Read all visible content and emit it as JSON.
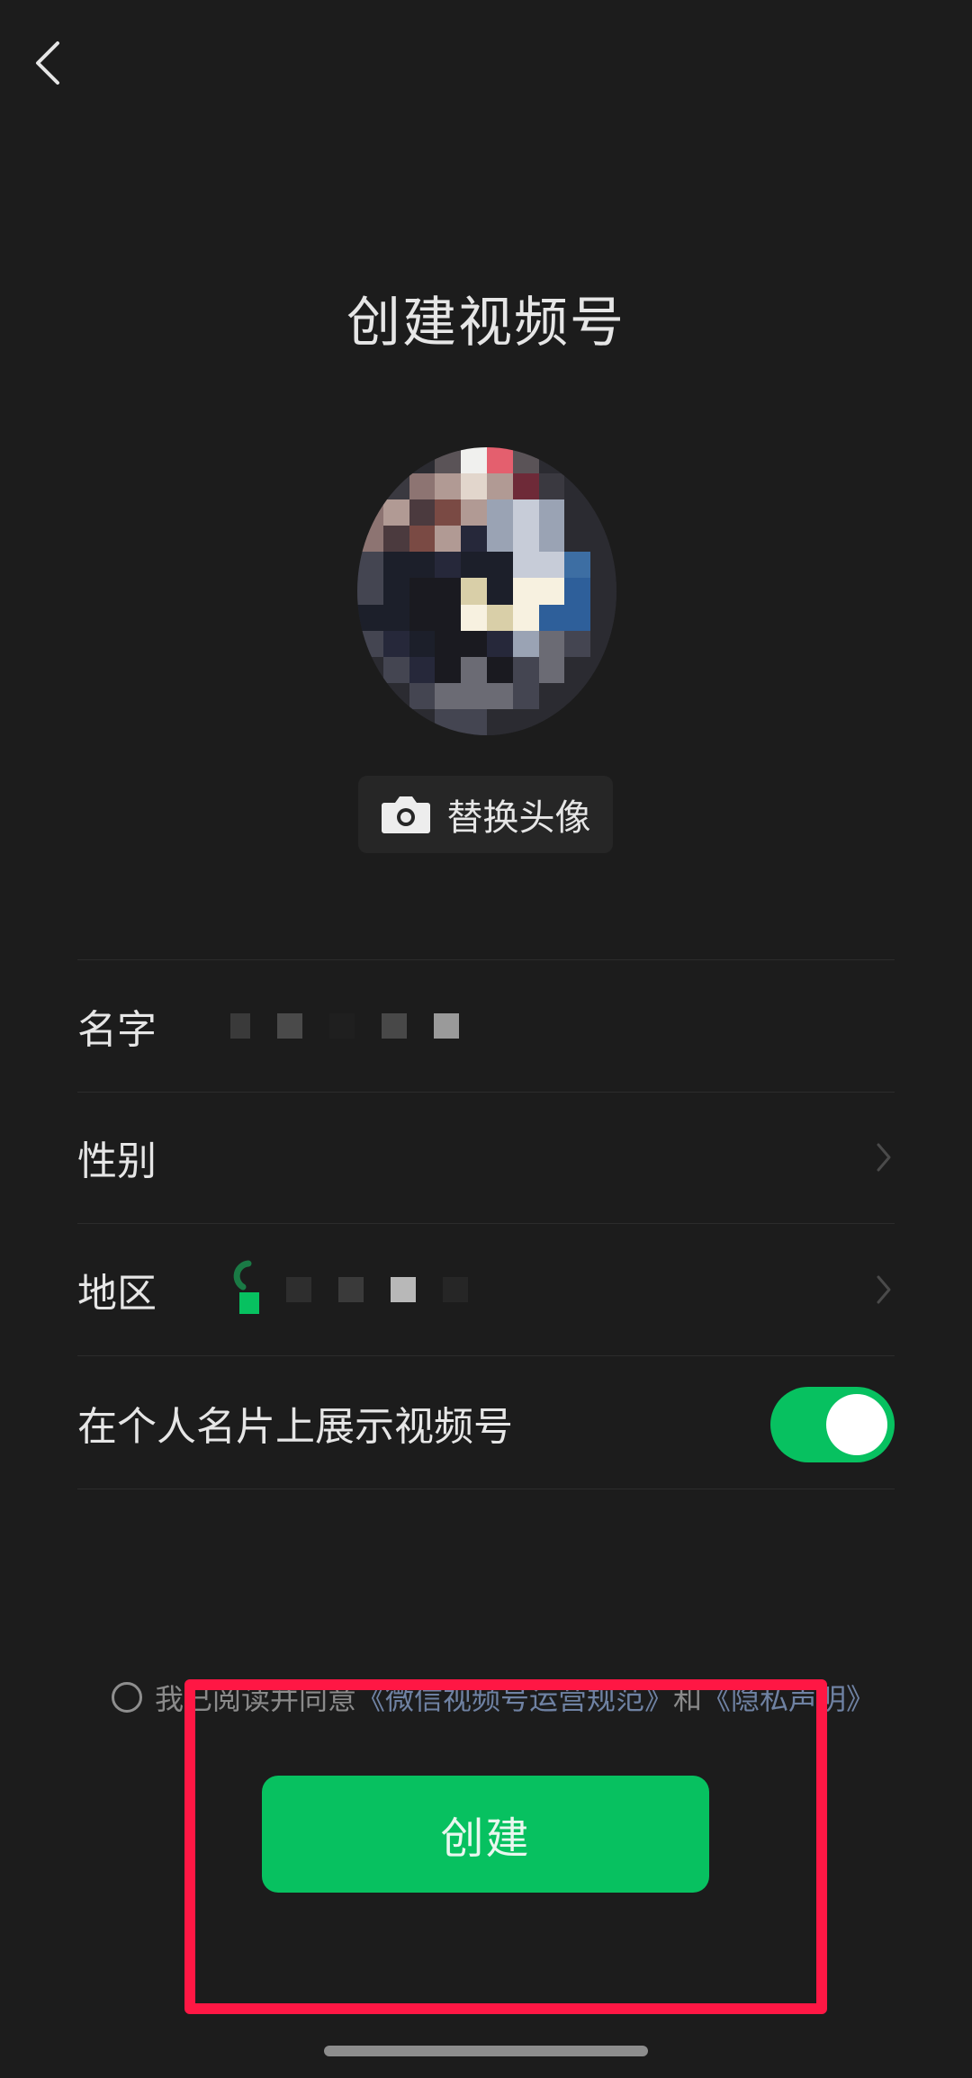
{
  "header": {
    "title": "创建视频号"
  },
  "avatar": {
    "change_label": "替换头像"
  },
  "form": {
    "name_label": "名字",
    "gender_label": "性别",
    "region_label": "地区",
    "show_on_card_label": "在个人名片上展示视频号",
    "show_on_card_enabled": true
  },
  "agreement": {
    "prefix": "我已阅读并同意",
    "link1": "《微信视频号运营规范》",
    "conj": "和",
    "link2": "《隐私声明》"
  },
  "actions": {
    "create_label": "创建"
  },
  "colors": {
    "background": "#1c1c1c",
    "accent": "#07c160",
    "highlight": "#ff1744",
    "link": "#6f82a3"
  }
}
